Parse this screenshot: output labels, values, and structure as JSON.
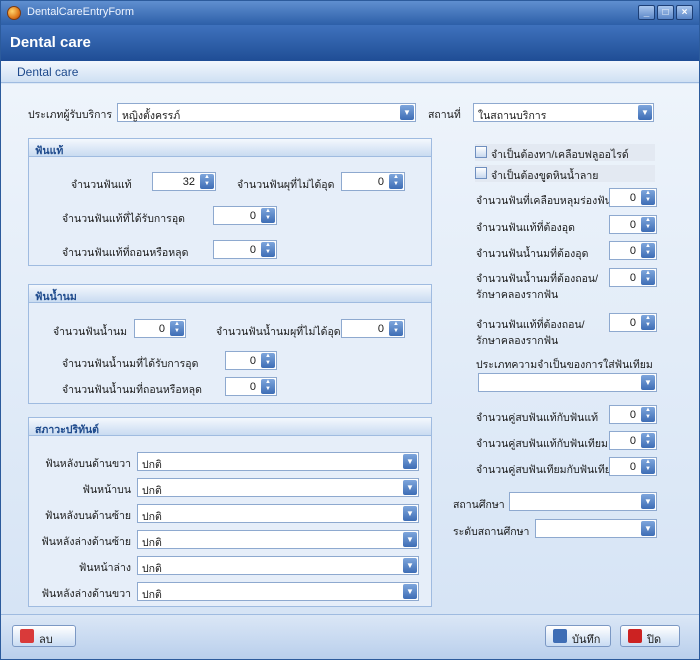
{
  "window": {
    "title": "DentalCareEntryForm",
    "minimize_glyph": "_",
    "maximize_glyph": "□",
    "close_glyph": "×"
  },
  "header": {
    "title": "Dental care"
  },
  "subheader": {
    "title": "Dental care"
  },
  "top": {
    "service_type_label": "ประเภทผู้รับบริการ",
    "service_type_value": "หญิงตั้งครรภ์",
    "place_label": "สถานที่",
    "place_value": "ในสถานบริการ"
  },
  "permanent": {
    "title": "ฟันแท้",
    "count_label": "จำนวนฟันแท้",
    "count_value": "32",
    "untreated_label": "จำนวนฟันผุที่ไม่ได้อุด",
    "untreated_value": "0",
    "filled_label": "จำนวนฟันแท้ที่ได้รับการอุด",
    "filled_value": "0",
    "extracted_label": "จำนวนฟันแท้ที่ถอนหรือหลุด",
    "extracted_value": "0"
  },
  "primary": {
    "title": "ฟันน้ำนม",
    "count_label": "จำนวนฟันน้ำนม",
    "count_value": "0",
    "untreated_label": "จำนวนฟันน้ำนมผุที่ไม่ได้อุด",
    "untreated_value": "0",
    "filled_label": "จำนวนฟันน้ำนมที่ได้รับการอุด",
    "filled_value": "0",
    "extracted_label": "จำนวนฟันน้ำนมที่ถอนหรือหลุด",
    "extracted_value": "0"
  },
  "periodontal": {
    "title": "สภาวะปริทันต์",
    "rows": [
      {
        "label": "ฟันหลังบนด้านขวา",
        "value": "ปกติ"
      },
      {
        "label": "ฟันหน้าบน",
        "value": "ปกติ"
      },
      {
        "label": "ฟันหลังบนด้านซ้าย",
        "value": "ปกติ"
      },
      {
        "label": "ฟันหลังล่างด้านซ้าย",
        "value": "ปกติ"
      },
      {
        "label": "ฟันหน้าล่าง",
        "value": "ปกติ"
      },
      {
        "label": "ฟันหลังล่างด้านขวา",
        "value": "ปกติ"
      }
    ]
  },
  "right": {
    "fluoride_label": "จำเป็นต้องทา/เคลือบฟลูออไรด์",
    "scaling_label": "จำเป็นต้องขูดหินน้ำลาย",
    "sealant_label": "จำนวนฟันที่เคลือบหลุมร่องฟัน",
    "sealant_value": "0",
    "perm_fill_needed_label": "จำนวนฟันแท้ที่ต้องอุด",
    "perm_fill_needed_value": "0",
    "prim_fill_needed_label": "จำนวนฟันน้ำนมที่ต้องอุด",
    "prim_fill_needed_value": "0",
    "prim_extract_label_1": "จำนวนฟันน้ำนมที่ต้องถอน/",
    "prim_extract_label_2": "รักษาคลองรากฟัน",
    "prim_extract_value": "0",
    "perm_extract_label_1": "จำนวนฟันแท้ที่ต้องถอน/",
    "perm_extract_label_2": "รักษาคลองรากฟัน",
    "perm_extract_value": "0",
    "denture_need_label": "ประเภทความจำเป็นของการใส่ฟันเทียม",
    "denture_need_value": "",
    "pairs_perm_perm_label": "จำนวนคู่สบฟันแท้กับฟันแท้",
    "pairs_perm_perm_value": "0",
    "pairs_perm_denture_label": "จำนวนคู่สบฟันแท้กับฟันเทียม",
    "pairs_perm_denture_value": "0",
    "pairs_denture_denture_label": "จำนวนคู่สบฟันเทียมกับฟันเทียม",
    "pairs_denture_denture_value": "0",
    "school_label": "สถานศึกษา",
    "school_value": "",
    "school_level_label": "ระดับสถานศึกษา",
    "school_level_value": ""
  },
  "footer": {
    "delete_label": "ลบ",
    "save_label": "บันทึก",
    "close_label": "ปิด"
  },
  "colors": {
    "header": "#2d5fa8",
    "accent": "#3e6db5",
    "delete_icon": "#d93a3a",
    "close_icon": "#cc2222"
  }
}
